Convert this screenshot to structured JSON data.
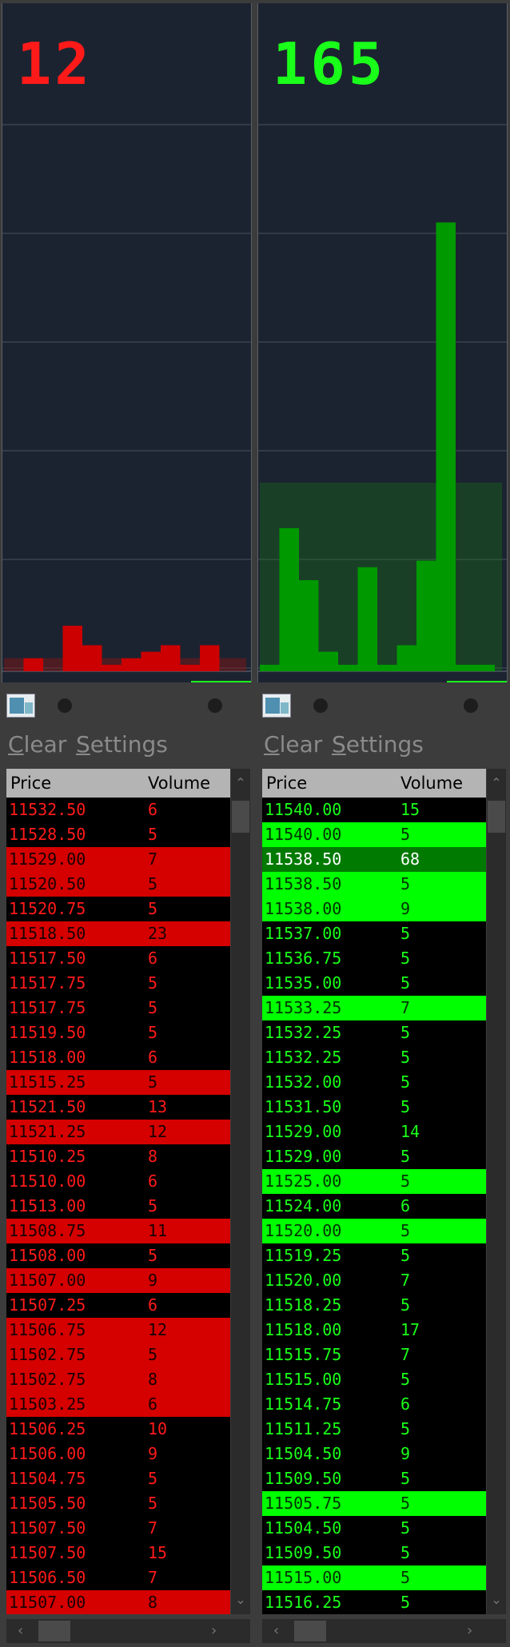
{
  "colors": {
    "sell_text": "#ff1a1a",
    "sell_highlight_bg": "#d50000",
    "sell_highlight_text": "#1a0000",
    "buy_text": "#1aff1a",
    "buy_highlight_bg": "#00ff00",
    "buy_highlight_text": "#003300",
    "buy_strong_bg": "#007a00",
    "buy_strong_text": "#ffffff",
    "chart_bg": "#1c2330"
  },
  "sell": {
    "count": "12",
    "toolbar": {
      "clear": "Clear",
      "settings": "Settings"
    },
    "columns": {
      "price": "Price",
      "volume": "Volume"
    },
    "rows": [
      {
        "price": "11532.50",
        "volume": "6",
        "hl": 0
      },
      {
        "price": "11528.50",
        "volume": "5",
        "hl": 0
      },
      {
        "price": "11529.00",
        "volume": "7",
        "hl": 1
      },
      {
        "price": "11520.50",
        "volume": "5",
        "hl": 1
      },
      {
        "price": "11520.75",
        "volume": "5",
        "hl": 0
      },
      {
        "price": "11518.50",
        "volume": "23",
        "hl": 1
      },
      {
        "price": "11517.50",
        "volume": "6",
        "hl": 0
      },
      {
        "price": "11517.75",
        "volume": "5",
        "hl": 0
      },
      {
        "price": "11517.75",
        "volume": "5",
        "hl": 0
      },
      {
        "price": "11519.50",
        "volume": "5",
        "hl": 0
      },
      {
        "price": "11518.00",
        "volume": "6",
        "hl": 0
      },
      {
        "price": "11515.25",
        "volume": "5",
        "hl": 1
      },
      {
        "price": "11521.50",
        "volume": "13",
        "hl": 0
      },
      {
        "price": "11521.25",
        "volume": "12",
        "hl": 1
      },
      {
        "price": "11510.25",
        "volume": "8",
        "hl": 0
      },
      {
        "price": "11510.00",
        "volume": "6",
        "hl": 0
      },
      {
        "price": "11513.00",
        "volume": "5",
        "hl": 0
      },
      {
        "price": "11508.75",
        "volume": "11",
        "hl": 1
      },
      {
        "price": "11508.00",
        "volume": "5",
        "hl": 0
      },
      {
        "price": "11507.00",
        "volume": "9",
        "hl": 1
      },
      {
        "price": "11507.25",
        "volume": "6",
        "hl": 0
      },
      {
        "price": "11506.75",
        "volume": "12",
        "hl": 1
      },
      {
        "price": "11502.75",
        "volume": "5",
        "hl": 1
      },
      {
        "price": "11502.75",
        "volume": "8",
        "hl": 1
      },
      {
        "price": "11503.25",
        "volume": "6",
        "hl": 1
      },
      {
        "price": "11506.25",
        "volume": "10",
        "hl": 0
      },
      {
        "price": "11506.00",
        "volume": "9",
        "hl": 0
      },
      {
        "price": "11504.75",
        "volume": "5",
        "hl": 0
      },
      {
        "price": "11505.50",
        "volume": "5",
        "hl": 0
      },
      {
        "price": "11507.50",
        "volume": "7",
        "hl": 0
      },
      {
        "price": "11507.50",
        "volume": "15",
        "hl": 0
      },
      {
        "price": "11506.50",
        "volume": "7",
        "hl": 0
      },
      {
        "price": "11507.00",
        "volume": "8",
        "hl": 1
      }
    ],
    "histogram": [
      0,
      2,
      0,
      7,
      4,
      1,
      2,
      3,
      4,
      1,
      4,
      0
    ],
    "histogram_shade": 2
  },
  "buy": {
    "count": "165",
    "toolbar": {
      "clear": "Clear",
      "settings": "Settings"
    },
    "columns": {
      "price": "Price",
      "volume": "Volume"
    },
    "rows": [
      {
        "price": "11540.00",
        "volume": "15",
        "hl": 0
      },
      {
        "price": "11540.00",
        "volume": "5",
        "hl": 1
      },
      {
        "price": "11538.50",
        "volume": "68",
        "hl": 2
      },
      {
        "price": "11538.50",
        "volume": "5",
        "hl": 1
      },
      {
        "price": "11538.00",
        "volume": "9",
        "hl": 1
      },
      {
        "price": "11537.00",
        "volume": "5",
        "hl": 0
      },
      {
        "price": "11536.75",
        "volume": "5",
        "hl": 0
      },
      {
        "price": "11535.00",
        "volume": "5",
        "hl": 0
      },
      {
        "price": "11533.25",
        "volume": "7",
        "hl": 1
      },
      {
        "price": "11532.25",
        "volume": "5",
        "hl": 0
      },
      {
        "price": "11532.25",
        "volume": "5",
        "hl": 0
      },
      {
        "price": "11532.00",
        "volume": "5",
        "hl": 0
      },
      {
        "price": "11531.50",
        "volume": "5",
        "hl": 0
      },
      {
        "price": "11529.00",
        "volume": "14",
        "hl": 0
      },
      {
        "price": "11529.00",
        "volume": "5",
        "hl": 0
      },
      {
        "price": "11525.00",
        "volume": "5",
        "hl": 1
      },
      {
        "price": "11524.00",
        "volume": "6",
        "hl": 0
      },
      {
        "price": "11520.00",
        "volume": "5",
        "hl": 1
      },
      {
        "price": "11519.25",
        "volume": "5",
        "hl": 0
      },
      {
        "price": "11520.00",
        "volume": "7",
        "hl": 0
      },
      {
        "price": "11518.25",
        "volume": "5",
        "hl": 0
      },
      {
        "price": "11518.00",
        "volume": "17",
        "hl": 0
      },
      {
        "price": "11515.75",
        "volume": "7",
        "hl": 0
      },
      {
        "price": "11515.00",
        "volume": "5",
        "hl": 0
      },
      {
        "price": "11514.75",
        "volume": "6",
        "hl": 0
      },
      {
        "price": "11511.25",
        "volume": "5",
        "hl": 0
      },
      {
        "price": "11504.50",
        "volume": "9",
        "hl": 0
      },
      {
        "price": "11509.50",
        "volume": "5",
        "hl": 0
      },
      {
        "price": "11505.75",
        "volume": "5",
        "hl": 1
      },
      {
        "price": "11504.50",
        "volume": "5",
        "hl": 0
      },
      {
        "price": "11509.50",
        "volume": "5",
        "hl": 0
      },
      {
        "price": "11515.00",
        "volume": "5",
        "hl": 1
      },
      {
        "price": "11516.25",
        "volume": "5",
        "hl": 0
      }
    ],
    "histogram": [
      1,
      22,
      14,
      3,
      1,
      16,
      1,
      4,
      17,
      69,
      1,
      1
    ],
    "histogram_shade": 29
  },
  "chart_data": [
    {
      "type": "bar",
      "title": "",
      "xlabel": "",
      "ylabel": "",
      "series": [
        {
          "values": [
            0,
            2,
            0,
            7,
            4,
            1,
            2,
            3,
            4,
            1,
            4,
            0
          ]
        }
      ]
    },
    {
      "type": "bar",
      "title": "",
      "xlabel": "",
      "ylabel": "",
      "series": [
        {
          "values": [
            1,
            22,
            14,
            3,
            1,
            16,
            1,
            4,
            17,
            69,
            1,
            1
          ]
        }
      ]
    }
  ]
}
